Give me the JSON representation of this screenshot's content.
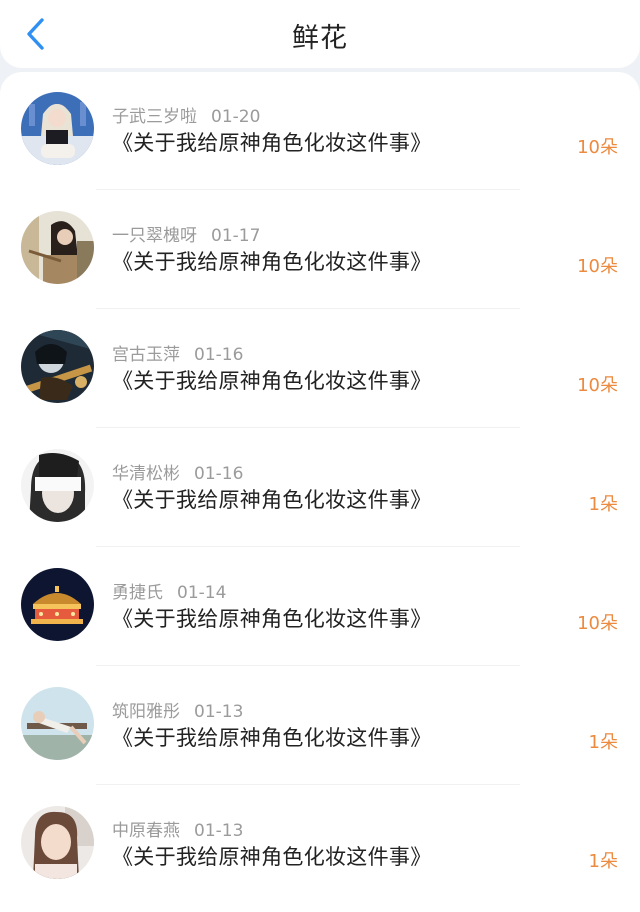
{
  "header": {
    "back_icon": "chevron-left-icon",
    "title": "鲜花",
    "accent": "#2f8ff2"
  },
  "colors": {
    "name": "#9b9b9b",
    "count": "#ec8a3f"
  },
  "gifts": [
    {
      "name": "子武三岁啦",
      "date": "01-20",
      "work": "《关于我给原神角色化妆这件事》",
      "count": "10朵"
    },
    {
      "name": "一只翠槐呀",
      "date": "01-17",
      "work": "《关于我给原神角色化妆这件事》",
      "count": "10朵"
    },
    {
      "name": "宫古玉萍",
      "date": "01-16",
      "work": "《关于我给原神角色化妆这件事》",
      "count": "10朵"
    },
    {
      "name": "华清松彬",
      "date": "01-16",
      "work": "《关于我给原神角色化妆这件事》",
      "count": "1朵"
    },
    {
      "name": "勇捷氏",
      "date": "01-14",
      "work": "《关于我给原神角色化妆这件事》",
      "count": "10朵"
    },
    {
      "name": "筑阳雅彤",
      "date": "01-13",
      "work": "《关于我给原神角色化妆这件事》",
      "count": "1朵"
    },
    {
      "name": "中原春燕",
      "date": "01-13",
      "work": "《关于我给原神角色化妆这件事》",
      "count": "1朵"
    }
  ]
}
